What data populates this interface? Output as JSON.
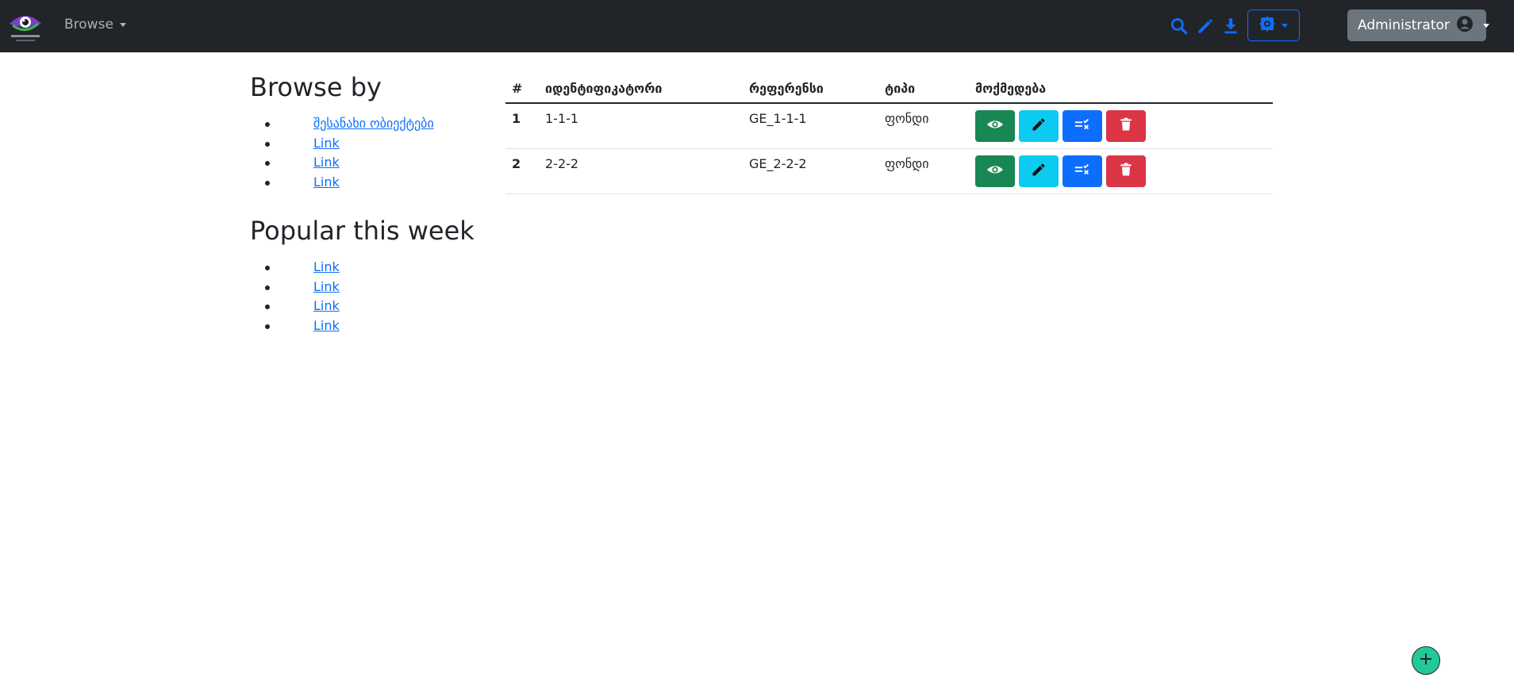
{
  "navbar": {
    "logo_icon": "eye-logo-icon",
    "browse_label": "Browse",
    "icons": [
      "search-icon",
      "pencil-icon",
      "download-icon",
      "settings-icon"
    ],
    "admin_label": "Administrator",
    "accent": "#0d6efd"
  },
  "sidebar": {
    "browse_title": "Browse by",
    "browse_links": [
      "შესანახი ობიექტები",
      "Link",
      "Link",
      "Link"
    ],
    "popular_title": "Popular this week",
    "popular_links": [
      "Link",
      "Link",
      "Link",
      "Link"
    ]
  },
  "table": {
    "headers": [
      "#",
      "იდენტიფიკატორი",
      "რეფერენსი",
      "ტიპი",
      "მოქმედება"
    ],
    "rows": [
      {
        "num": "1",
        "identifier": "1-1-1",
        "reference": "GE_1-1-1",
        "type": "ფონდი"
      },
      {
        "num": "2",
        "identifier": "2-2-2",
        "reference": "GE_2-2-2",
        "type": "ფონდი"
      }
    ],
    "action_icons": [
      "eye-icon",
      "pencil-icon",
      "checklist-icon",
      "trash-icon"
    ]
  },
  "fab": {
    "icon": "plus-icon",
    "color": "#20c997"
  }
}
